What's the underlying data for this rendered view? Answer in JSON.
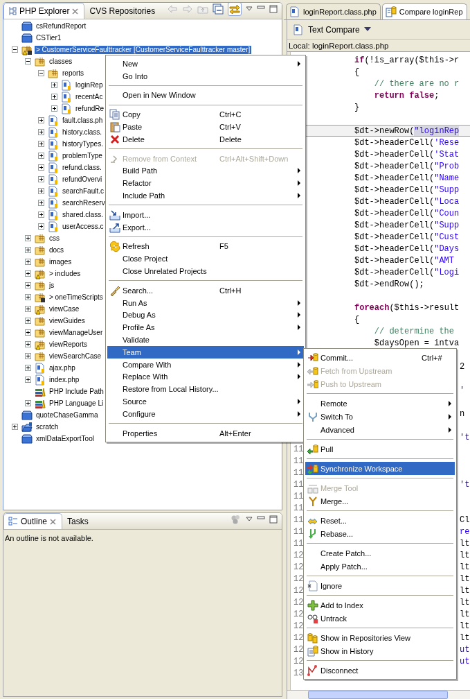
{
  "explorer": {
    "tabs": [
      {
        "label": "PHP Explorer",
        "selected": true
      },
      {
        "label": "CVS Repositories",
        "selected": false
      }
    ],
    "tree": [
      {
        "label": "csRefundReport",
        "kind": "closed-project",
        "selected": false
      },
      {
        "label": "CSTier1",
        "kind": "closed-project",
        "selected": false
      },
      {
        "label": "> CustomerServiceFaulttracker [CustomerServiceFaulttracker master]",
        "kind": "php-project",
        "selected": true,
        "expanded": true,
        "children": [
          {
            "label": "classes",
            "kind": "folder",
            "selected": false,
            "expanded": true,
            "children": [
              {
                "label": "reports",
                "kind": "folder",
                "selected": false,
                "expanded": true,
                "children": [
                  {
                    "label": "loginRep",
                    "kind": "php-file",
                    "selected": false,
                    "expanded": false
                  },
                  {
                    "label": "recentAc",
                    "kind": "php-file",
                    "selected": false,
                    "expanded": false
                  },
                  {
                    "label": "refundRe",
                    "kind": "php-file",
                    "selected": false,
                    "expanded": false
                  }
                ]
              },
              {
                "label": "fault.class.ph",
                "kind": "php-file",
                "selected": false,
                "expanded": false
              },
              {
                "label": "history.class.",
                "kind": "php-file",
                "selected": false,
                "expanded": false
              },
              {
                "label": "historyTypes.",
                "kind": "php-file",
                "selected": false,
                "expanded": false
              },
              {
                "label": "problemType",
                "kind": "php-file",
                "selected": false,
                "expanded": false
              },
              {
                "label": "refund.class.",
                "kind": "php-file",
                "selected": false,
                "expanded": false
              },
              {
                "label": "refundOvervi",
                "kind": "php-file",
                "selected": false,
                "expanded": false
              },
              {
                "label": "searchFault.c",
                "kind": "php-file",
                "selected": false,
                "expanded": false
              },
              {
                "label": "searchReserv",
                "kind": "php-file",
                "selected": false,
                "expanded": false
              },
              {
                "label": "shared.class.",
                "kind": "php-file",
                "selected": false,
                "expanded": false
              },
              {
                "label": "userAccess.c",
                "kind": "php-file",
                "selected": false,
                "expanded": false
              }
            ]
          },
          {
            "label": "css",
            "kind": "folder",
            "selected": false,
            "expanded": false
          },
          {
            "label": "docs",
            "kind": "folder",
            "selected": false,
            "expanded": false
          },
          {
            "label": "images",
            "kind": "folder",
            "selected": false,
            "expanded": false
          },
          {
            "label": "> includes",
            "kind": "folder-warning",
            "selected": false,
            "expanded": false
          },
          {
            "label": "js",
            "kind": "folder",
            "selected": false,
            "expanded": false
          },
          {
            "label": "> oneTimeScripts",
            "kind": "folder-new",
            "selected": false,
            "expanded": false
          },
          {
            "label": "viewCase",
            "kind": "folder-warning",
            "selected": false,
            "expanded": false
          },
          {
            "label": "viewGuides",
            "kind": "folder",
            "selected": false,
            "expanded": false
          },
          {
            "label": "viewManageUser",
            "kind": "folder",
            "selected": false,
            "expanded": false
          },
          {
            "label": "viewReports",
            "kind": "folder-warning",
            "selected": false,
            "expanded": false
          },
          {
            "label": "viewSearchCase",
            "kind": "folder",
            "selected": false,
            "expanded": false
          },
          {
            "label": "ajax.php",
            "kind": "php-file",
            "selected": false,
            "expanded": false
          },
          {
            "label": "index.php",
            "kind": "php-file",
            "selected": false,
            "expanded": false
          },
          {
            "label": "PHP Include Path",
            "kind": "library",
            "selected": false
          },
          {
            "label": "PHP Language Li",
            "kind": "library",
            "selected": false,
            "expanded": false
          }
        ]
      },
      {
        "label": "quoteChaseGamma",
        "kind": "closed-project",
        "selected": false
      },
      {
        "label": "scratch",
        "kind": "open-project",
        "selected": false,
        "expanded": false
      },
      {
        "label": "xmlDataExportTool",
        "kind": "closed-project",
        "selected": false
      }
    ]
  },
  "outline": {
    "tabs": [
      {
        "label": "Outline",
        "selected": true
      },
      {
        "label": "Tasks",
        "selected": false
      }
    ],
    "message": "An outline is not available."
  },
  "editor": {
    "tabs": [
      {
        "label": "loginReport.class.php",
        "selected": false
      },
      {
        "label": "Compare loginRep",
        "selected": true
      }
    ],
    "compare_mode": "Text Compare",
    "pane_title": "Local: loginReport.class.php",
    "lines": [
      {
        "kind": "code",
        "highlighted": false,
        "tokens": [
          {
            "kind": "keyword",
            "text": "if"
          },
          {
            "kind": "plain",
            "text": "(!is_array($this->r"
          }
        ]
      },
      {
        "kind": "code",
        "highlighted": false,
        "tokens": [
          {
            "kind": "plain",
            "text": "{"
          }
        ]
      },
      {
        "kind": "code",
        "highlighted": false,
        "tokens": [
          {
            "kind": "comment",
            "text": "    // there are no r"
          }
        ]
      },
      {
        "kind": "code",
        "highlighted": false,
        "tokens": [
          {
            "kind": "keyword",
            "text": "    return false"
          },
          {
            "kind": "plain",
            "text": ";"
          }
        ]
      },
      {
        "kind": "code",
        "highlighted": false,
        "tokens": [
          {
            "kind": "plain",
            "text": "}"
          }
        ]
      },
      {
        "kind": "blank",
        "highlighted": false
      },
      {
        "kind": "code",
        "highlighted": true,
        "tokens": [
          {
            "kind": "plain",
            "text": "$dt->newRow("
          },
          {
            "kind": "diff",
            "text": "\"loginRep"
          }
        ]
      },
      {
        "kind": "code",
        "highlighted": false,
        "tokens": [
          {
            "kind": "plain",
            "text": "$dt->headerCell("
          },
          {
            "kind": "string",
            "text": "'Rese"
          }
        ]
      },
      {
        "kind": "code",
        "highlighted": false,
        "tokens": [
          {
            "kind": "plain",
            "text": "$dt->headerCell("
          },
          {
            "kind": "string",
            "text": "'Stat"
          }
        ]
      },
      {
        "kind": "code",
        "highlighted": false,
        "tokens": [
          {
            "kind": "plain",
            "text": "$dt->headerCell("
          },
          {
            "kind": "string",
            "text": "\"Prob"
          }
        ]
      },
      {
        "kind": "code",
        "highlighted": false,
        "tokens": [
          {
            "kind": "plain",
            "text": "$dt->headerCell("
          },
          {
            "kind": "string",
            "text": "\"Name"
          }
        ]
      },
      {
        "kind": "code",
        "highlighted": false,
        "tokens": [
          {
            "kind": "plain",
            "text": "$dt->headerCell("
          },
          {
            "kind": "string",
            "text": "\"Supp"
          }
        ]
      },
      {
        "kind": "code",
        "highlighted": false,
        "tokens": [
          {
            "kind": "plain",
            "text": "$dt->headerCell("
          },
          {
            "kind": "string",
            "text": "\"Loca"
          }
        ]
      },
      {
        "kind": "code",
        "highlighted": false,
        "tokens": [
          {
            "kind": "plain",
            "text": "$dt->headerCell("
          },
          {
            "kind": "string",
            "text": "\"Coun"
          }
        ]
      },
      {
        "kind": "code",
        "highlighted": false,
        "tokens": [
          {
            "kind": "plain",
            "text": "$dt->headerCell("
          },
          {
            "kind": "string",
            "text": "\"Supp"
          }
        ]
      },
      {
        "kind": "code",
        "highlighted": false,
        "tokens": [
          {
            "kind": "plain",
            "text": "$dt->headerCell("
          },
          {
            "kind": "string",
            "text": "\"Cust"
          }
        ]
      },
      {
        "kind": "code",
        "highlighted": false,
        "tokens": [
          {
            "kind": "plain",
            "text": "$dt->headerCell("
          },
          {
            "kind": "string",
            "text": "\"Days"
          }
        ]
      },
      {
        "kind": "code",
        "highlighted": false,
        "tokens": [
          {
            "kind": "plain",
            "text": "$dt->headerCell("
          },
          {
            "kind": "string",
            "text": "\"AMT"
          }
        ]
      },
      {
        "kind": "code",
        "highlighted": false,
        "tokens": [
          {
            "kind": "plain",
            "text": "$dt->headerCell("
          },
          {
            "kind": "string",
            "text": "\"Logi"
          }
        ]
      },
      {
        "kind": "code",
        "highlighted": false,
        "tokens": [
          {
            "kind": "plain",
            "text": "$dt->endRow();"
          }
        ]
      },
      {
        "kind": "blank",
        "highlighted": false
      },
      {
        "kind": "code",
        "highlighted": false,
        "tokens": [
          {
            "kind": "keyword",
            "text": "foreach"
          },
          {
            "kind": "plain",
            "text": "($this->result"
          }
        ]
      },
      {
        "kind": "code",
        "highlighted": false,
        "tokens": [
          {
            "kind": "plain",
            "text": "{"
          }
        ]
      },
      {
        "kind": "code",
        "highlighted": false,
        "tokens": [
          {
            "kind": "comment",
            "text": "    // determine the"
          }
        ]
      },
      {
        "kind": "code",
        "highlighted": false,
        "tokens": [
          {
            "kind": "plain",
            "text": "    $daysOpen = intva"
          }
        ]
      },
      {
        "kind": "blank",
        "highlighted": false
      },
      {
        "kind": "tail",
        "highlighted": false,
        "tokens": [
          {
            "kind": "plain",
            "text": "2"
          }
        ]
      },
      {
        "kind": "blank",
        "highlighted": false
      },
      {
        "kind": "tail",
        "highlighted": false,
        "tokens": [
          {
            "kind": "string",
            "text": "'"
          }
        ]
      },
      {
        "kind": "blank",
        "highlighted": false
      },
      {
        "kind": "tail",
        "highlighted": false,
        "tokens": [
          {
            "kind": "plain",
            "text": "n"
          }
        ]
      },
      {
        "kind": "blank",
        "highlighted": false
      },
      {
        "kind": "tail",
        "highlighted": false,
        "tokens": [
          {
            "kind": "string",
            "text": "'t"
          }
        ]
      },
      {
        "kind": "blank",
        "highlighted": false,
        "number": "11"
      },
      {
        "kind": "blank",
        "highlighted": false,
        "number": "11"
      },
      {
        "kind": "blank",
        "highlighted": false,
        "number": "11"
      },
      {
        "kind": "tail",
        "highlighted": false,
        "number": "11",
        "tokens": [
          {
            "kind": "string",
            "text": "'t"
          }
        ]
      },
      {
        "kind": "blank",
        "highlighted": false,
        "number": "11"
      },
      {
        "kind": "blank",
        "highlighted": false,
        "number": "11"
      },
      {
        "kind": "tail",
        "highlighted": false,
        "number": "11",
        "tokens": [
          {
            "kind": "plain",
            "text": "Cl"
          }
        ]
      },
      {
        "kind": "tail",
        "highlighted": false,
        "number": "11",
        "tokens": [
          {
            "kind": "string",
            "text": "re"
          }
        ]
      },
      {
        "kind": "tail",
        "highlighted": false,
        "number": "11",
        "tokens": [
          {
            "kind": "plain",
            "text": "lt"
          }
        ]
      },
      {
        "kind": "tail",
        "highlighted": false,
        "number": "12",
        "tokens": [
          {
            "kind": "plain",
            "text": "lt"
          }
        ]
      },
      {
        "kind": "tail",
        "highlighted": false,
        "number": "12",
        "tokens": [
          {
            "kind": "plain",
            "text": "lt"
          }
        ]
      },
      {
        "kind": "tail",
        "highlighted": false,
        "number": "12",
        "tokens": [
          {
            "kind": "plain",
            "text": "lt"
          }
        ]
      },
      {
        "kind": "tail",
        "highlighted": false,
        "number": "12",
        "tokens": [
          {
            "kind": "plain",
            "text": "lt"
          }
        ]
      },
      {
        "kind": "tail",
        "highlighted": false,
        "number": "12",
        "tokens": [
          {
            "kind": "plain",
            "text": "lt"
          }
        ]
      },
      {
        "kind": "tail",
        "highlighted": false,
        "number": "12",
        "tokens": [
          {
            "kind": "plain",
            "text": "lt"
          }
        ]
      },
      {
        "kind": "tail",
        "highlighted": false,
        "number": "12",
        "tokens": [
          {
            "kind": "plain",
            "text": "lt"
          }
        ]
      },
      {
        "kind": "tail",
        "highlighted": false,
        "number": "12",
        "tokens": [
          {
            "kind": "plain",
            "text": "lt"
          }
        ]
      },
      {
        "kind": "tail",
        "highlighted": false,
        "number": "12",
        "tokens": [
          {
            "kind": "string",
            "text": "ut"
          }
        ]
      },
      {
        "kind": "tail",
        "highlighted": false,
        "number": "12",
        "tokens": [
          {
            "kind": "string",
            "text": "ut"
          }
        ]
      },
      {
        "kind": "blank",
        "highlighted": false,
        "number": "13"
      }
    ]
  },
  "context_menu": {
    "items": [
      {
        "kind": "item",
        "label": "New",
        "submenu": true,
        "disabled": false,
        "selected": false
      },
      {
        "kind": "item",
        "label": "Go Into",
        "submenu": false,
        "disabled": false,
        "selected": false
      },
      {
        "kind": "separator"
      },
      {
        "kind": "item",
        "label": "Open in New Window",
        "submenu": false,
        "disabled": false,
        "selected": false
      },
      {
        "kind": "separator"
      },
      {
        "kind": "item",
        "label": "Copy",
        "shortcut": "Ctrl+C",
        "submenu": false,
        "disabled": false,
        "selected": false
      },
      {
        "kind": "item",
        "label": "Paste",
        "shortcut": "Ctrl+V",
        "submenu": false,
        "disabled": false,
        "selected": false
      },
      {
        "kind": "item",
        "label": "Delete",
        "shortcut": "Delete",
        "submenu": false,
        "disabled": false,
        "selected": false
      },
      {
        "kind": "separator"
      },
      {
        "kind": "item",
        "label": "Remove from Context",
        "shortcut": "Ctrl+Alt+Shift+Down",
        "submenu": false,
        "disabled": true,
        "selected": false
      },
      {
        "kind": "item",
        "label": "Build Path",
        "submenu": true,
        "disabled": false,
        "selected": false
      },
      {
        "kind": "item",
        "label": "Refactor",
        "submenu": true,
        "disabled": false,
        "selected": false
      },
      {
        "kind": "item",
        "label": "Include Path",
        "submenu": true,
        "disabled": false,
        "selected": false
      },
      {
        "kind": "separator"
      },
      {
        "kind": "item",
        "label": "Import...",
        "submenu": false,
        "disabled": false,
        "selected": false
      },
      {
        "kind": "item",
        "label": "Export...",
        "submenu": false,
        "disabled": false,
        "selected": false
      },
      {
        "kind": "separator"
      },
      {
        "kind": "item",
        "label": "Refresh",
        "shortcut": "F5",
        "submenu": false,
        "disabled": false,
        "selected": false
      },
      {
        "kind": "item",
        "label": "Close Project",
        "submenu": false,
        "disabled": false,
        "selected": false
      },
      {
        "kind": "item",
        "label": "Close Unrelated Projects",
        "submenu": false,
        "disabled": false,
        "selected": false
      },
      {
        "kind": "separator"
      },
      {
        "kind": "item",
        "label": "Search...",
        "shortcut": "Ctrl+H",
        "submenu": false,
        "disabled": false,
        "selected": false
      },
      {
        "kind": "item",
        "label": "Run As",
        "submenu": true,
        "disabled": false,
        "selected": false
      },
      {
        "kind": "item",
        "label": "Debug As",
        "submenu": true,
        "disabled": false,
        "selected": false
      },
      {
        "kind": "item",
        "label": "Profile As",
        "submenu": true,
        "disabled": false,
        "selected": false
      },
      {
        "kind": "item",
        "label": "Validate",
        "submenu": false,
        "disabled": false,
        "selected": false
      },
      {
        "kind": "item",
        "label": "Team",
        "submenu": true,
        "disabled": false,
        "selected": true
      },
      {
        "kind": "item",
        "label": "Compare With",
        "submenu": true,
        "disabled": false,
        "selected": false
      },
      {
        "kind": "item",
        "label": "Replace With",
        "submenu": true,
        "disabled": false,
        "selected": false
      },
      {
        "kind": "item",
        "label": "Restore from Local History...",
        "submenu": false,
        "disabled": false,
        "selected": false
      },
      {
        "kind": "item",
        "label": "Source",
        "submenu": true,
        "disabled": false,
        "selected": false
      },
      {
        "kind": "item",
        "label": "Configure",
        "submenu": true,
        "disabled": false,
        "selected": false
      },
      {
        "kind": "separator"
      },
      {
        "kind": "item",
        "label": "Properties",
        "shortcut": "Alt+Enter",
        "submenu": false,
        "disabled": false,
        "selected": false
      }
    ]
  },
  "team_submenu": {
    "items": [
      {
        "kind": "item",
        "label": "Commit...",
        "shortcut": "Ctrl+#",
        "submenu": false,
        "disabled": false,
        "selected": false
      },
      {
        "kind": "item",
        "label": "Fetch from Upstream",
        "submenu": false,
        "disabled": true,
        "selected": false
      },
      {
        "kind": "item",
        "label": "Push to Upstream",
        "submenu": false,
        "disabled": true,
        "selected": false
      },
      {
        "kind": "separator"
      },
      {
        "kind": "item",
        "label": "Remote",
        "submenu": true,
        "disabled": false,
        "selected": false
      },
      {
        "kind": "item",
        "label": "Switch To",
        "submenu": true,
        "disabled": false,
        "selected": false
      },
      {
        "kind": "item",
        "label": "Advanced",
        "submenu": true,
        "disabled": false,
        "selected": false
      },
      {
        "kind": "separator"
      },
      {
        "kind": "item",
        "label": "Pull",
        "submenu": false,
        "disabled": false,
        "selected": false
      },
      {
        "kind": "separator"
      },
      {
        "kind": "item",
        "label": "Synchronize Workspace",
        "submenu": false,
        "disabled": false,
        "selected": true
      },
      {
        "kind": "separator"
      },
      {
        "kind": "item",
        "label": "Merge Tool",
        "submenu": false,
        "disabled": true,
        "selected": false
      },
      {
        "kind": "item",
        "label": "Merge...",
        "submenu": false,
        "disabled": false,
        "selected": false
      },
      {
        "kind": "separator"
      },
      {
        "kind": "item",
        "label": "Reset...",
        "submenu": false,
        "disabled": false,
        "selected": false
      },
      {
        "kind": "item",
        "label": "Rebase...",
        "submenu": false,
        "disabled": false,
        "selected": false
      },
      {
        "kind": "separator"
      },
      {
        "kind": "item",
        "label": "Create Patch...",
        "submenu": false,
        "disabled": false,
        "selected": false
      },
      {
        "kind": "item",
        "label": "Apply Patch...",
        "submenu": false,
        "disabled": false,
        "selected": false
      },
      {
        "kind": "separator"
      },
      {
        "kind": "item",
        "label": "Ignore",
        "submenu": false,
        "disabled": false,
        "selected": false
      },
      {
        "kind": "separator"
      },
      {
        "kind": "item",
        "label": "Add to Index",
        "submenu": false,
        "disabled": false,
        "selected": false
      },
      {
        "kind": "item",
        "label": "Untrack",
        "submenu": false,
        "disabled": false,
        "selected": false
      },
      {
        "kind": "separator"
      },
      {
        "kind": "item",
        "label": "Show in Repositories View",
        "submenu": false,
        "disabled": false,
        "selected": false
      },
      {
        "kind": "item",
        "label": "Show in History",
        "submenu": false,
        "disabled": false,
        "selected": false
      },
      {
        "kind": "separator"
      },
      {
        "kind": "item",
        "label": "Disconnect",
        "submenu": false,
        "disabled": false,
        "selected": false
      }
    ]
  }
}
